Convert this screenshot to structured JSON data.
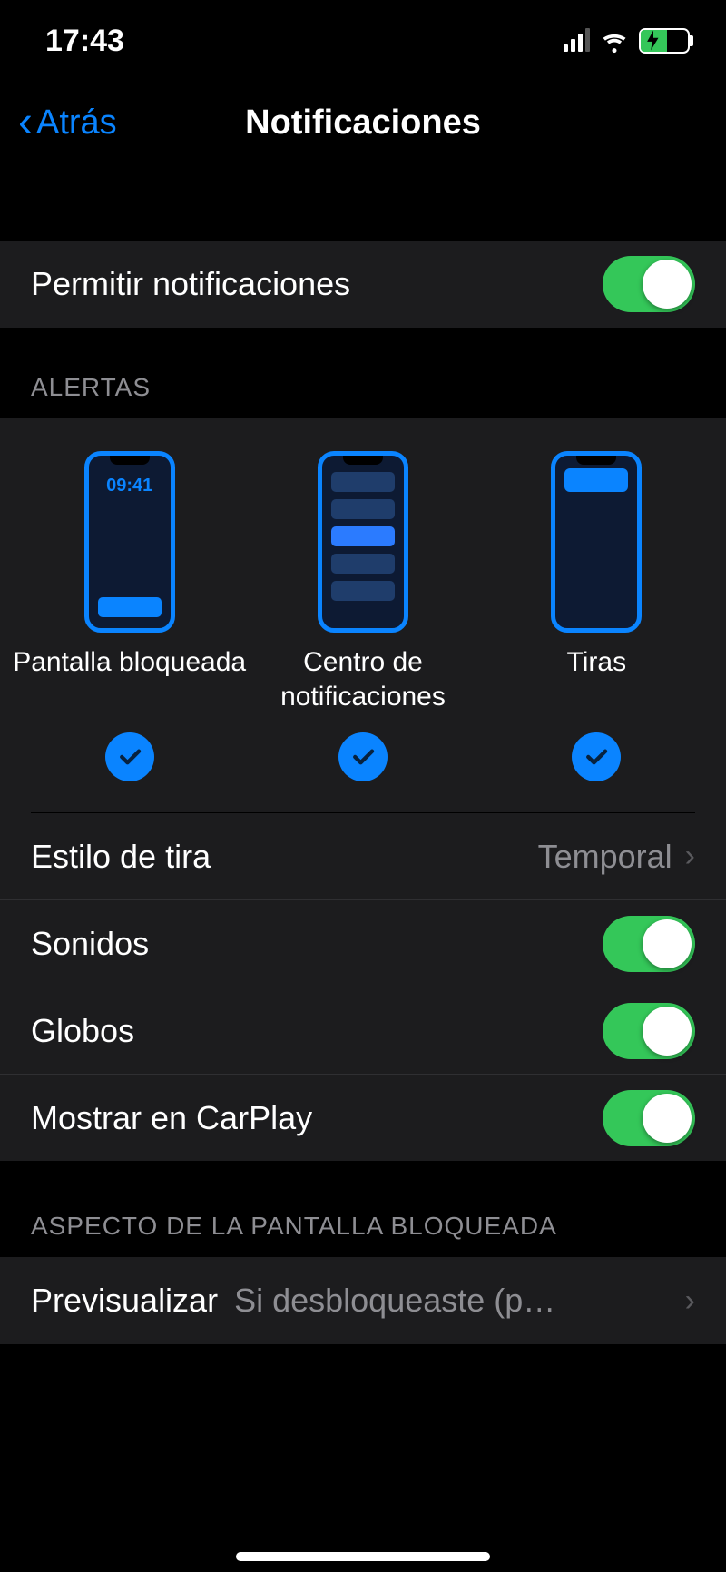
{
  "status": {
    "time": "17:43"
  },
  "nav": {
    "back_label": "Atrás",
    "title": "Notificaciones"
  },
  "allow": {
    "label": "Permitir notificaciones",
    "enabled": true
  },
  "alerts": {
    "header": "ALERTAS",
    "lock_time": "09:41",
    "items": [
      {
        "label": "Pantalla bloqueada",
        "checked": true
      },
      {
        "label": "Centro de notificaciones",
        "checked": true
      },
      {
        "label": "Tiras",
        "checked": true
      }
    ],
    "banner_style": {
      "label": "Estilo de tira",
      "value": "Temporal"
    },
    "sounds": {
      "label": "Sonidos",
      "enabled": true
    },
    "badges": {
      "label": "Globos",
      "enabled": true
    },
    "carplay": {
      "label": "Mostrar en CarPlay",
      "enabled": true
    }
  },
  "lockscreen": {
    "header": "ASPECTO DE LA PANTALLA BLOQUEADA",
    "preview": {
      "label": "Previsualizar",
      "value": "Si desbloqueaste (p…"
    }
  }
}
